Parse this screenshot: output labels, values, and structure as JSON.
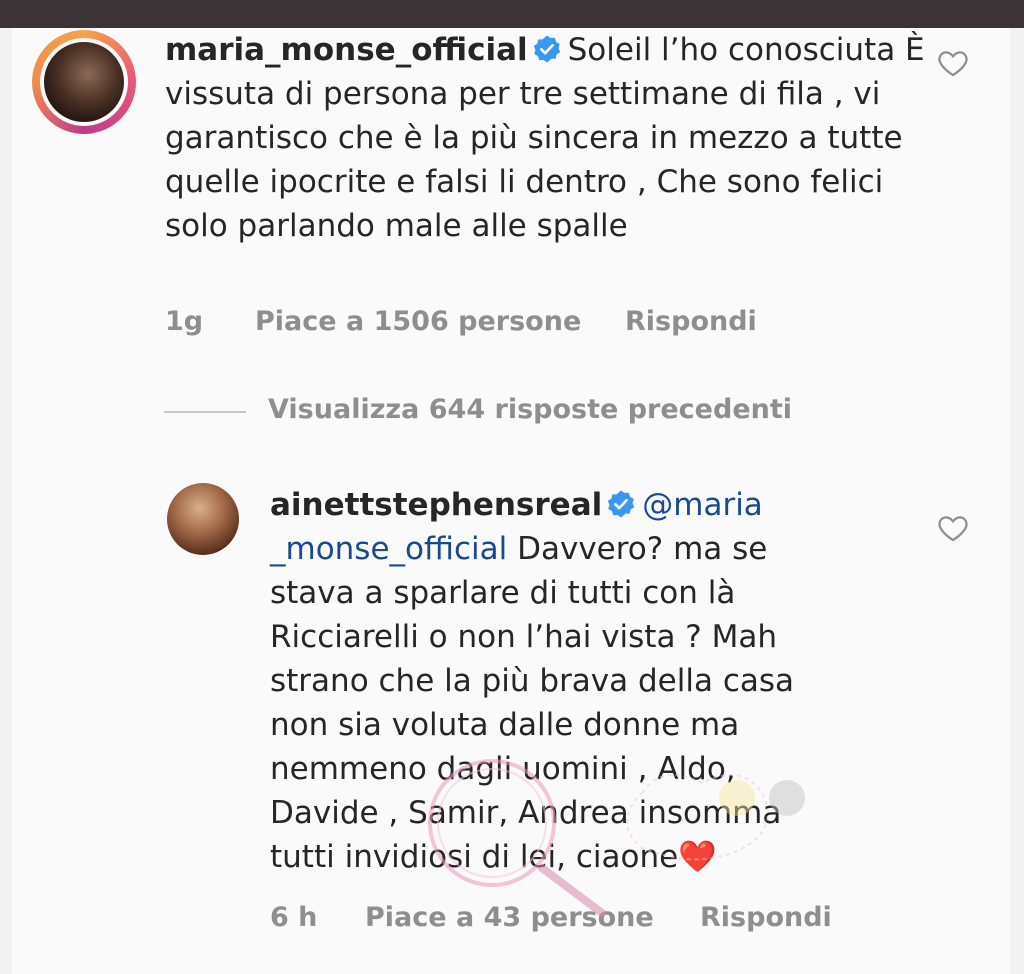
{
  "comments": [
    {
      "username": "maria_monse_official",
      "verified": true,
      "text": "Soleil l’ho conosciuta È vissuta di persona per tre settimane di fila , vi garantisco che è la più sincera in mezzo a tutte quelle ipocrite e falsi li dentro , Che sono felici solo parlando male alle spalle",
      "time": "1g",
      "likes": "Piace a 1506 persone",
      "reply": "Rispondi"
    },
    {
      "username": "ainettstephensreal",
      "verified": true,
      "mention": "@maria _monse_official",
      "text": "Davvero? ma se stava a sparlare di tutti con là Ricciarelli o non l’hai vista ? Mah strano che la più brava della casa non sia voluta dalle donne ma nemmeno dagli uomini , Aldo, Davide , Samir, Andrea insomma tutti invidiosi di lei, ciaone❤️",
      "time": "6 h",
      "likes": "Piace a 43 persone",
      "reply": "Rispondi"
    }
  ],
  "view_replies": "Visualizza 644 risposte precedenti",
  "colors": {
    "verified": "#3897f0",
    "mention": "#1a4a8e",
    "meta": "#8e8e8e",
    "top_bar": "#3b3336"
  },
  "icons": [
    "verified-badge-icon",
    "heart-outline-icon"
  ]
}
